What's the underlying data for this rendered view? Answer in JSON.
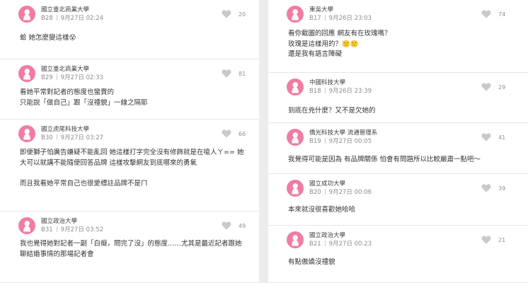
{
  "left_column": [
    {
      "school": "國立臺北商業大學",
      "floor": "B28",
      "time": "9月27日 02:24",
      "likes": "20",
      "lines": [
        "蛤 她怎麼變這樣😵"
      ]
    },
    {
      "school": "國立臺北商業大學",
      "floor": "B29",
      "time": "9月27日 02:33",
      "likes": "81",
      "lines": [
        "看她平常對記者的態度也蠻賣的",
        "只能說「做自己」跟「沒禮貌」一線之隔耶"
      ]
    },
    {
      "school": "國立虎尾科技大學",
      "floor": "B30",
      "time": "9月27日 03:27",
      "likes": "66",
      "lines": [
        "即便獅子怕廣告嫌疑不能亂回 她這樣打字完全沒有修飾就是在嗆人ㄚ== 她",
        "大可以就講不能隨便回答品牌 這樣攻擊網友到底哪來的勇氣",
        "",
        "而且我看她平常自己也很愛標註品牌不是ㄇ"
      ]
    },
    {
      "school": "國立政治大學",
      "floor": "B31",
      "time": "9月27日 03:52",
      "likes": "49",
      "lines": [
        "我也覺得她對記者一副「白癡，問完了沒」的態度……尤其是最近記者跟她",
        "聊結婚事情的那場記者會"
      ]
    }
  ],
  "right_column": [
    {
      "school": "東吳大學",
      "floor": "B17",
      "time": "9月26日 23:03",
      "likes": "74",
      "lines": [
        "看你截圖的回應 網友有在玫瑰嗎？",
        "玫瑰是這樣用的？🙂🙂",
        "還是我有語言障礙"
      ]
    },
    {
      "school": "中國科技大學",
      "floor": "B18",
      "time": "9月26日 23:39",
      "likes": "29",
      "lines": [
        "到底在兇什麼？又不是欠她的"
      ]
    },
    {
      "school": "僑光科技大學 流通管理系",
      "floor": "B19",
      "time": "9月27日 00:05",
      "likes": "41",
      "lines": [
        "我覺得可能是因為 有品牌關係 怕會有問題所以比較嚴肅一點吧～"
      ]
    },
    {
      "school": "國立成功大學",
      "floor": "B20",
      "time": "9月27日 00:06",
      "likes": "39",
      "lines": [
        "本來就沒很喜歡她哈哈"
      ]
    },
    {
      "school": "國立政治大學",
      "floor": "B21",
      "time": "9月27日 00:23",
      "likes": "21",
      "lines": [
        "有點傲嬌沒禮貌"
      ]
    }
  ],
  "colors": {
    "avatar": "#f07ca3",
    "heart": "#c9c9c9",
    "divider": "#e6e6e6",
    "background": "#ffffff"
  },
  "icons": {
    "avatar": "avatar-silhouette-icon",
    "like": "heart-icon"
  }
}
